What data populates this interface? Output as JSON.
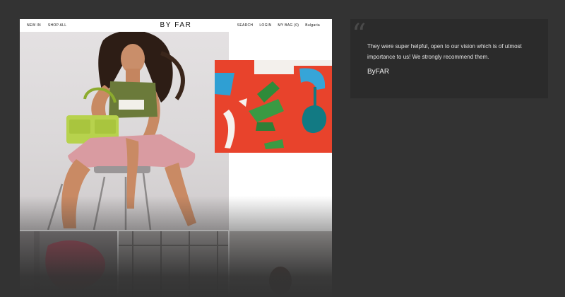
{
  "site": {
    "logo": "BY FAR",
    "nav_left": [
      "NEW IN",
      "SHOP ALL"
    ],
    "nav_right": [
      "SEARCH",
      "LOGIN",
      "MY BAG (0)",
      "Bulgaria"
    ]
  },
  "testimonial": {
    "quote": "They were super helpful, open to our vision which is of utmost importance to us! We strongly recommend them.",
    "author": "ByFAR",
    "quote_icon": "quote-icon"
  },
  "colors": {
    "page_background": "#333333",
    "card_background": "#2b2b2b",
    "product_background": "#e8432c"
  }
}
